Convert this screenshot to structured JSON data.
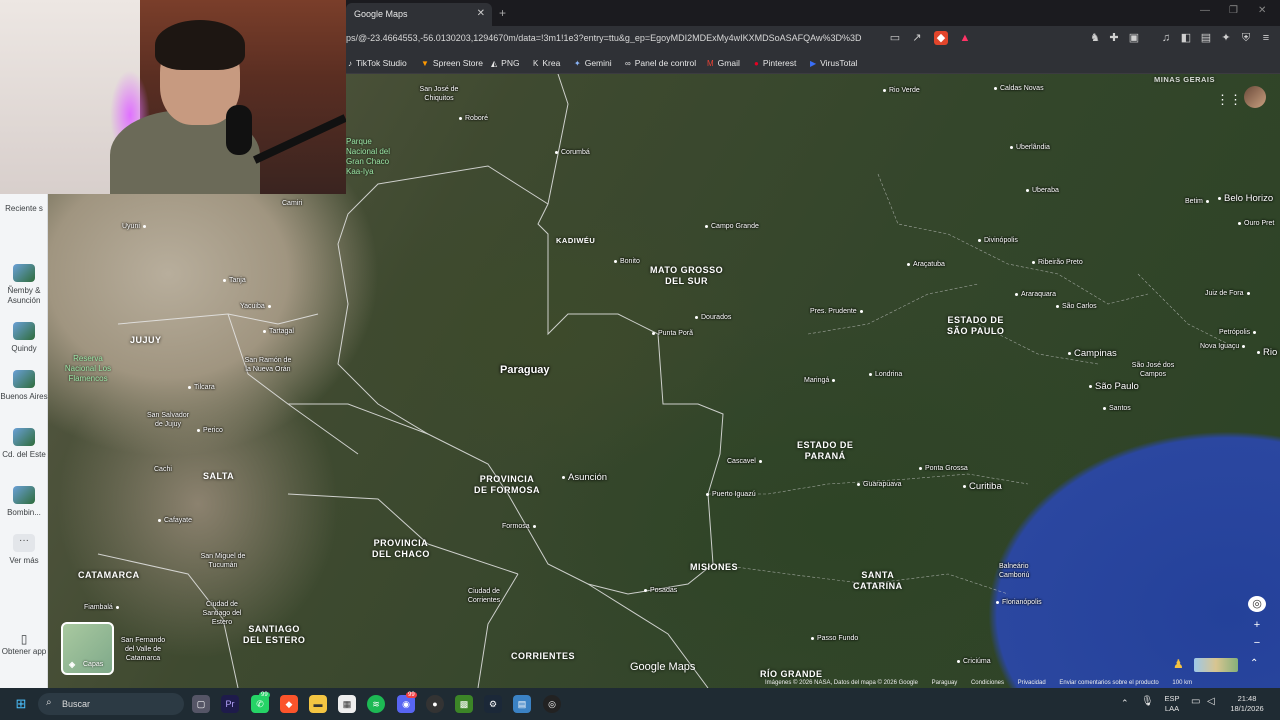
{
  "browser": {
    "tab_title": "Google Maps",
    "tab_close": "✕",
    "new_tab": "+",
    "url": "ps/@-23.4664553,-56.0130203,1294670m/data=!3m1!1e3?entry=ttu&g_ep=EgoyMDI2MDExMy4wIKXMDSoASAFQAw%3D%3D",
    "window_controls": [
      "—",
      "❐",
      "✕"
    ],
    "bookmarks": [
      {
        "icon": "tiktok-icon",
        "label": "TikTok Studio"
      },
      {
        "icon": "spreen-icon",
        "label": "Spreen Store"
      },
      {
        "icon": "png-icon",
        "label": "PNG"
      },
      {
        "icon": "krea-icon",
        "label": "Krea"
      },
      {
        "icon": "gemini-icon",
        "label": "Gemini"
      },
      {
        "icon": "link-icon",
        "label": "Panel de control"
      },
      {
        "icon": "gmail-icon",
        "label": "Gmail"
      },
      {
        "icon": "pinterest-icon",
        "label": "Pinterest"
      },
      {
        "icon": "virustotal-icon",
        "label": "VirusTotal"
      }
    ]
  },
  "sidebar": {
    "recent": "Reciente s",
    "items": [
      {
        "label": "Ñemby & Asunción"
      },
      {
        "label": "Quindy"
      },
      {
        "label": "Buenos Aires"
      },
      {
        "label": "Cd. del Este"
      },
      {
        "label": "Bombin..."
      }
    ],
    "more": "Ver más",
    "get_app": "Obtener app"
  },
  "map": {
    "country": "Paraguay",
    "regions": [
      {
        "id": "mato-grosso",
        "text": "MATO GROSSO\nDEL SUR"
      },
      {
        "id": "sao-paulo",
        "text": "ESTADO DE\nSÃO PAULO"
      },
      {
        "id": "parana",
        "text": "ESTADO DE\nPARANÁ"
      },
      {
        "id": "formosa",
        "text": "PROVINCIA\nDE FORMOSA"
      },
      {
        "id": "chaco",
        "text": "PROVINCIA\nDEL CHACO"
      },
      {
        "id": "misiones",
        "text": "MISIONES"
      },
      {
        "id": "santa-catarina",
        "text": "SANTA\nCATARINA"
      },
      {
        "id": "corrientes",
        "text": "CORRIENTES"
      },
      {
        "id": "rio-grande",
        "text": "RÍO GRANDE"
      },
      {
        "id": "jujuy",
        "text": "JUJUY"
      },
      {
        "id": "salta",
        "text": "SALTA"
      },
      {
        "id": "catamarca",
        "text": "CATAMARCA"
      },
      {
        "id": "santiago",
        "text": "SANTIAGO\nDEL ESTERO"
      },
      {
        "id": "kadiweu",
        "text": "KADIWÉU"
      },
      {
        "id": "minas",
        "text": "MINAS GERAIS"
      }
    ],
    "big_cities": [
      "Asunción",
      "Campinas",
      "São Paulo",
      "Curitiba",
      "Belo Horizo",
      "Rio"
    ],
    "places": [
      "San José de Chiquitos",
      "Roboré",
      "Corumbá",
      "Rio Verde",
      "Caldas Novas",
      "Uberlândia",
      "Uberaba",
      "Betim",
      "Ouro Pret",
      "Camiri",
      "Campo Grande",
      "Uyuni",
      "Bonito",
      "Divinópolis",
      "Tanja",
      "Yacuiba",
      "Tartagal",
      "Araçatuba",
      "Ribeirão Preto",
      "Juiz de Fora",
      "Dourados",
      "Araraquara",
      "São Carlos",
      "Petrópolis",
      "Nova Iguaçu",
      "Punta Porã",
      "Pres. Prudente",
      "San Ramón de la Nueva Orán",
      "Tilcara",
      "Maringá",
      "Londrina",
      "São José dos Campos",
      "Santos",
      "San Salvador de Jujuy",
      "Perico",
      "Cascavel",
      "Ponta Grossa",
      "Cachi",
      "Puerto Iguazú",
      "Guarapuava",
      "Cafayate",
      "Formosa",
      "San Miguel de Tucumán",
      "Balneário Camboriú",
      "Florianópolis",
      "Ciudad de Corrientes",
      "Posadas",
      "Fiambalá",
      "Ciudad de Santiago del Estero",
      "San Fernando del Valle de Catamarca",
      "Passo Fundo",
      "Criciúma"
    ],
    "parks": [
      "Parque Nacional del Gran Chaco Kaa-Iya",
      "Reserva Nacional Los Flamencos"
    ],
    "layers_label": "Capas",
    "brand": "Google Maps",
    "attribution": [
      "Imágenes © 2026 NASA, Datos del mapa © 2026 Google",
      "Paraguay",
      "Condiciones",
      "Privacidad",
      "Enviar comentarios sobre el producto",
      "100 km"
    ]
  },
  "taskbar": {
    "search_placeholder": "Buscar",
    "lang": "ESP\nLAA",
    "time": "21:48",
    "date": "18/1/2026",
    "badge_whatsapp": "99",
    "badge_discord": "99"
  },
  "colors": {
    "sea": "#2b47a0",
    "taskbar": "#1f2b33",
    "chrome": "#2f3136"
  }
}
